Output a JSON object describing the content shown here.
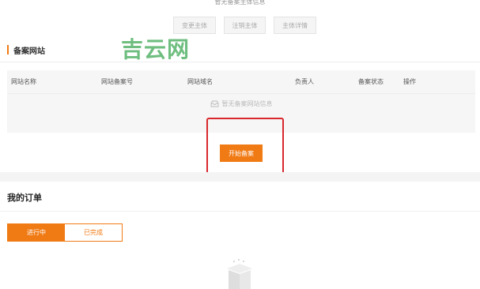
{
  "header": {
    "note": "暂无备案主体信息",
    "buttons": {
      "change": "变更主体",
      "cancel": "注销主体",
      "detail": "主体详情"
    }
  },
  "watermark": "吉云网",
  "website_section": {
    "title": "备案网站",
    "columns": [
      "网站名称",
      "网站备案号",
      "网站域名",
      "负责人",
      "备案状态",
      "操作"
    ],
    "empty_text": "暂无备案网站信息",
    "start_button": "开始备案"
  },
  "orders_section": {
    "title": "我的订单",
    "tabs": [
      "进行中",
      "已完成"
    ],
    "active_tab": "进行中"
  },
  "colors": {
    "accent": "#f07a14",
    "highlight": "#d9272c",
    "watermark": "#56b36a"
  }
}
